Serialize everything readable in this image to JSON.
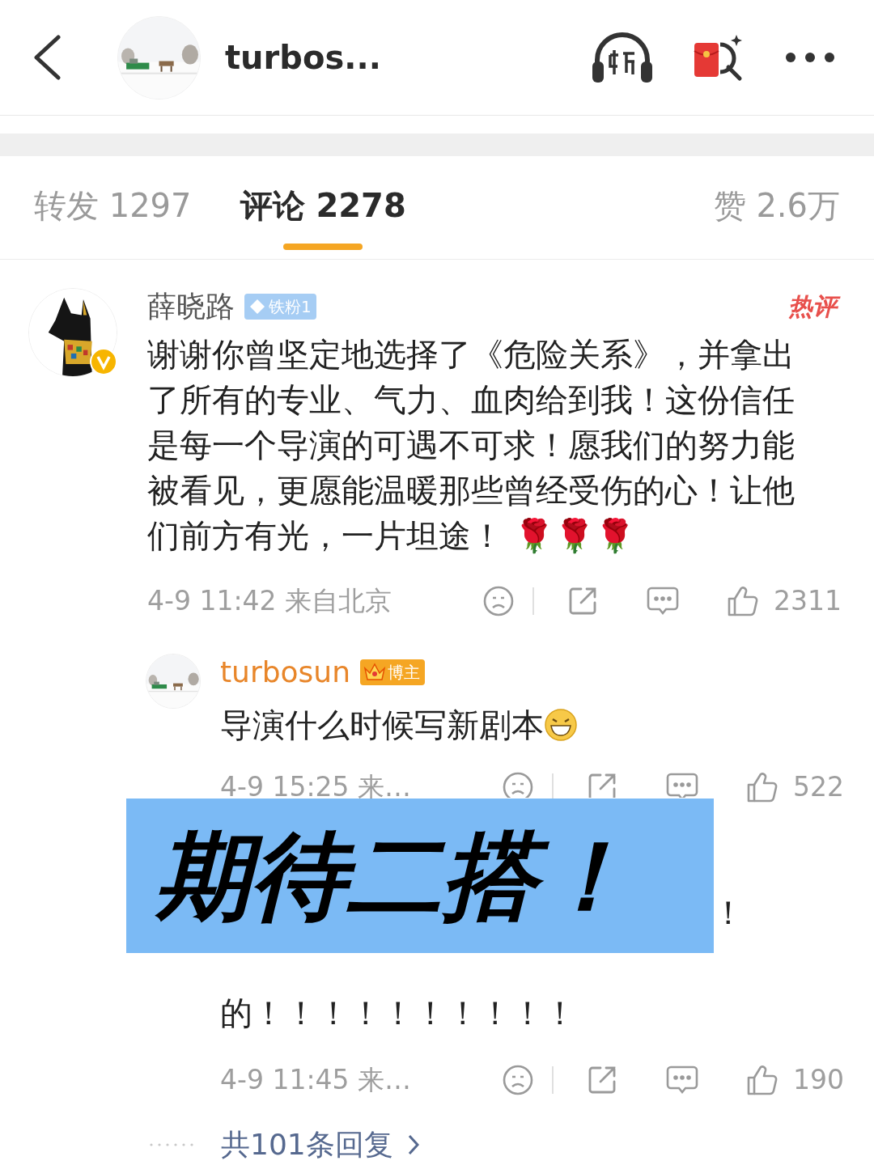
{
  "header": {
    "title": "turbos..."
  },
  "tabs": [
    {
      "label": "转发 1297",
      "selected": false
    },
    {
      "label": "评论 2278",
      "selected": true
    },
    {
      "label": "赞 2.6万",
      "selected": false
    }
  ],
  "comment": {
    "author": "薛晓路",
    "badge": "铁粉1",
    "hot_label": "热评",
    "text": "谢谢你曾坚定地选择了《危险关系》，并拿出了所有的专业、气力、血肉给到我！这份信任是每一个导演的可遇不可求！愿我们的努力能被看见，更愿能温暖那些曾经受伤的心！让他们前方有光，一片坦途！ 🌹🌹🌹",
    "time": "4-9 11:42 来自北京",
    "likes": "2311"
  },
  "replies": [
    {
      "kind": "full",
      "author": "turbosun",
      "badge": "博主",
      "text": "导演什么时候写新剧本",
      "time": "4-9 15:25 来…",
      "likes": "522"
    },
    {
      "kind": "covered",
      "covered_tail": "！",
      "text": "的！！！！！！！！！！",
      "time": "4-9 11:45 来…",
      "likes": "190"
    }
  ],
  "more_replies": {
    "label": "共101条回复"
  },
  "banner": {
    "text": "期待二搭！"
  }
}
